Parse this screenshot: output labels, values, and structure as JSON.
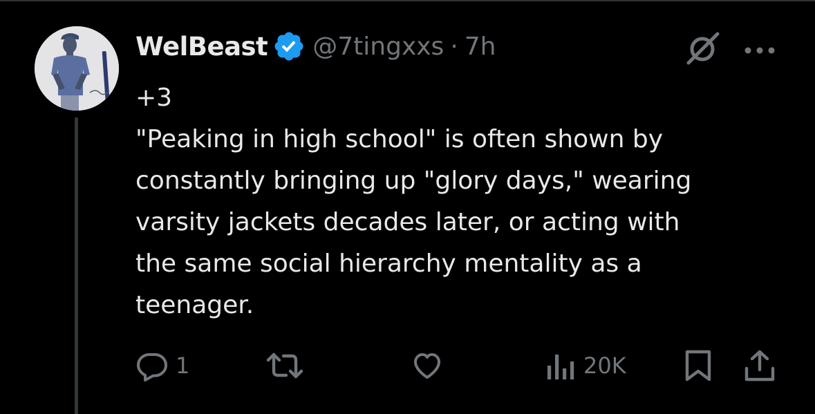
{
  "tweet": {
    "author": {
      "display_name": "WelBeast",
      "handle": "@7tingxxs",
      "verified": true
    },
    "separator": "·",
    "time": "7h",
    "text_lines": [
      "+3",
      "\"Peaking in high school\" is often shown by",
      "constantly bringing up \"glory days,\" wearing",
      "varsity jackets decades later, or acting with",
      "the same social hierarchy mentality as a",
      "teenager."
    ]
  },
  "actions": {
    "reply_count": "1",
    "views_count": "20K"
  },
  "icons": {
    "verified": "verified-badge-icon",
    "grok": "grok-icon",
    "more": "more-options-icon",
    "reply": "reply-icon",
    "retweet": "retweet-icon",
    "like": "like-icon",
    "views": "views-icon",
    "bookmark": "bookmark-icon",
    "share": "share-icon"
  },
  "colors": {
    "background": "#000000",
    "text": "#e7e9ea",
    "secondary": "#71767b",
    "verified_blue": "#1d9bf0",
    "thread_line": "#333639"
  }
}
